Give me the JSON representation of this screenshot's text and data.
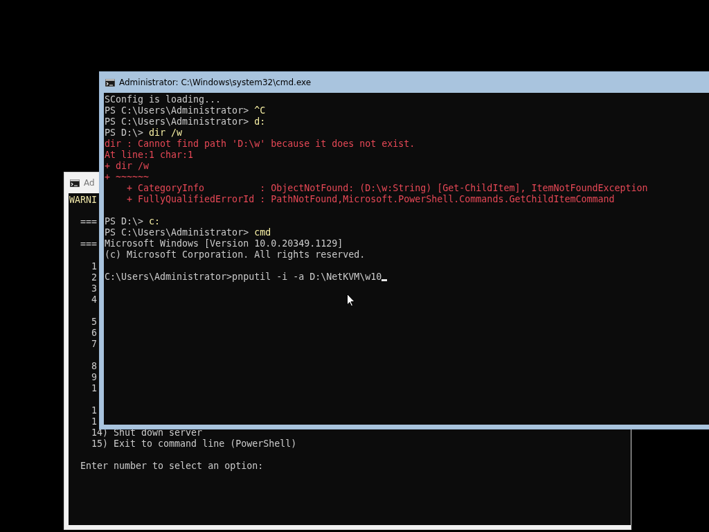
{
  "back_window": {
    "title": "Ad",
    "lines": [
      {
        "kind": "warning",
        "text": "WARNI"
      },
      {
        "kind": "blank"
      },
      {
        "kind": "normal",
        "text": "  ==="
      },
      {
        "kind": "blank"
      },
      {
        "kind": "normal",
        "text": "  ==="
      },
      {
        "kind": "blank"
      },
      {
        "kind": "normal",
        "text": "    1"
      },
      {
        "kind": "normal",
        "text": "    2"
      },
      {
        "kind": "normal",
        "text": "    3"
      },
      {
        "kind": "normal",
        "text": "    4"
      },
      {
        "kind": "blank"
      },
      {
        "kind": "normal",
        "text": "    5"
      },
      {
        "kind": "normal",
        "text": "    6"
      },
      {
        "kind": "normal",
        "text": "    7"
      },
      {
        "kind": "blank"
      },
      {
        "kind": "normal",
        "text": "    8"
      },
      {
        "kind": "normal",
        "text": "    9"
      },
      {
        "kind": "normal",
        "text": "    1"
      },
      {
        "kind": "blank"
      },
      {
        "kind": "normal",
        "text": "    1"
      },
      {
        "kind": "normal",
        "text": "    1"
      },
      {
        "kind": "normal",
        "text": "    14) Shut down server"
      },
      {
        "kind": "normal",
        "text": "    15) Exit to command line (PowerShell)"
      },
      {
        "kind": "blank"
      },
      {
        "kind": "normal",
        "text": "  Enter number to select an option:"
      }
    ]
  },
  "front_window": {
    "title": "Administrator: C:\\Windows\\system32\\cmd.exe",
    "lines": [
      {
        "kind": "normal",
        "text": "SConfig is loading..."
      },
      {
        "kind": "prompt",
        "prompt": "PS C:\\Users\\Administrator> ",
        "command": "^C"
      },
      {
        "kind": "prompt",
        "prompt": "PS C:\\Users\\Administrator> ",
        "command": "d:"
      },
      {
        "kind": "prompt",
        "prompt": "PS D:\\> ",
        "command": "dir /w"
      },
      {
        "kind": "error",
        "text": "dir : Cannot find path 'D:\\w' because it does not exist."
      },
      {
        "kind": "error",
        "text": "At line:1 char:1"
      },
      {
        "kind": "error",
        "text": "+ dir /w"
      },
      {
        "kind": "error",
        "text": "+ ~~~~~~"
      },
      {
        "kind": "error",
        "text": "    + CategoryInfo          : ObjectNotFound: (D:\\w:String) [Get-ChildItem], ItemNotFoundException"
      },
      {
        "kind": "error",
        "text": "    + FullyQualifiedErrorId : PathNotFound,Microsoft.PowerShell.Commands.GetChildItemCommand"
      },
      {
        "kind": "blank"
      },
      {
        "kind": "prompt",
        "prompt": "PS D:\\> ",
        "command": "c:"
      },
      {
        "kind": "prompt",
        "prompt": "PS C:\\Users\\Administrator> ",
        "command": "cmd"
      },
      {
        "kind": "normal",
        "text": "Microsoft Windows [Version 10.0.20349.1129]"
      },
      {
        "kind": "normal",
        "text": "(c) Microsoft Corporation. All rights reserved."
      },
      {
        "kind": "blank"
      },
      {
        "kind": "input",
        "text": "C:\\Users\\Administrator>pnputil -i -a D:\\NetKVM\\w10"
      }
    ]
  }
}
